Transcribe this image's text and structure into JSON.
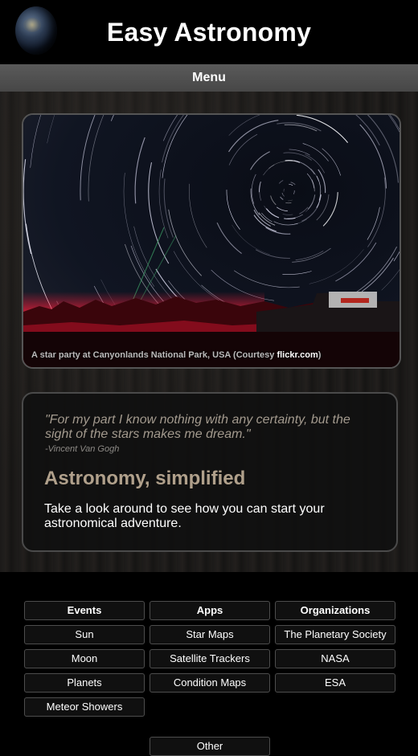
{
  "header": {
    "title": "Easy Astronomy",
    "logo_icon": "globe-icon"
  },
  "menu": {
    "label": "Menu"
  },
  "hero": {
    "caption_text": "A star party at Canyonlands National Park, USA (Courtesy ",
    "caption_link": "flickr.com",
    "caption_end": ")"
  },
  "quote_box": {
    "quote": "\"For my part I know nothing with any certainty, but the sight of the stars makes me dream.\"",
    "author": "-Vincent Van Gogh",
    "heading": "Astronomy, simplified",
    "intro": "Take a look around to see how you can start your astronomical adventure."
  },
  "footer": {
    "columns": [
      {
        "heading": "Events",
        "items": [
          "Sun",
          "Moon",
          "Planets",
          "Meteor Showers"
        ]
      },
      {
        "heading": "Apps",
        "items": [
          "Star Maps",
          "Satellite Trackers",
          "Condition Maps"
        ]
      },
      {
        "heading": "Organizations",
        "items": [
          "The Planetary Society",
          "NASA",
          "ESA"
        ]
      }
    ],
    "partial_button": "Other"
  },
  "colors": {
    "background": "#000000",
    "menu_bar": "#4f4f4f",
    "quote_text": "#a39a8e",
    "heading_text": "#b0a08b",
    "button_border": "#4d4d4d"
  }
}
